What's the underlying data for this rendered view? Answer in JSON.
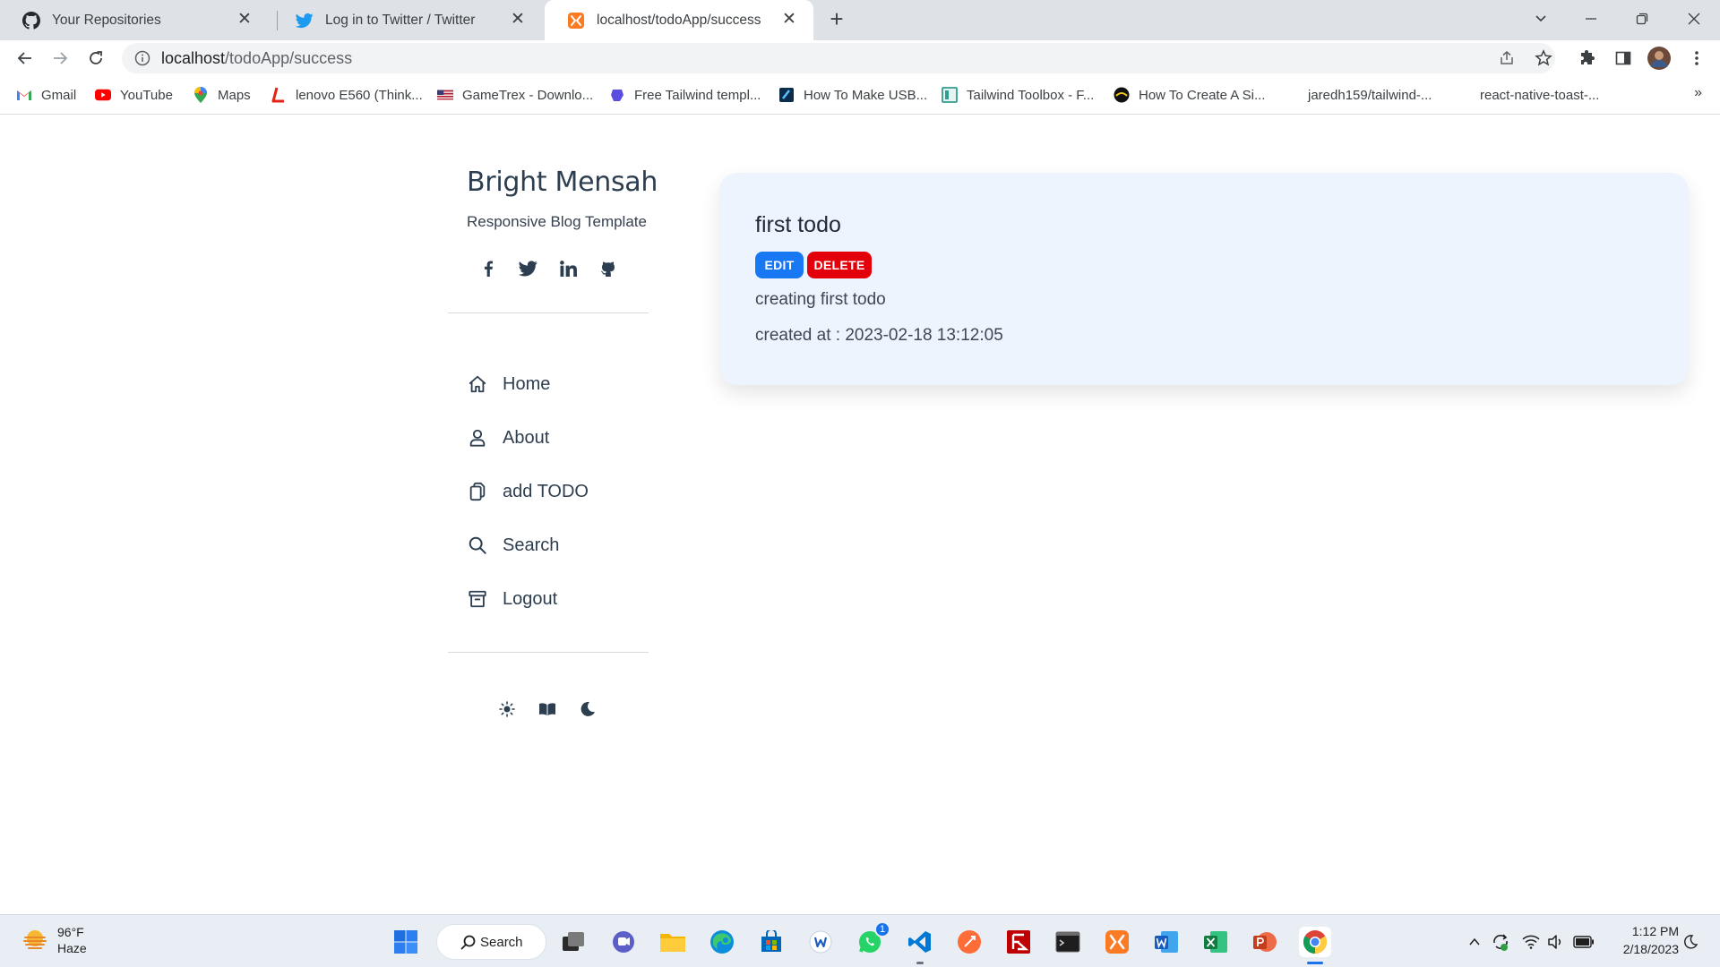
{
  "browser": {
    "tabs": [
      {
        "title": "Your Repositories",
        "icon": "github-icon"
      },
      {
        "title": "Log in to Twitter / Twitter",
        "icon": "twitter-icon"
      },
      {
        "title": "localhost/todoApp/success",
        "icon": "xampp-icon",
        "active": true
      }
    ],
    "address": {
      "host": "localhost",
      "path": "/todoApp/success"
    },
    "bookmarks": [
      {
        "label": "Gmail",
        "icon": "gmail-icon"
      },
      {
        "label": "YouTube",
        "icon": "youtube-icon"
      },
      {
        "label": "Maps",
        "icon": "maps-icon"
      },
      {
        "label": "lenovo E560 (Think...",
        "icon": "lenovo-icon"
      },
      {
        "label": "GameTrex - Downlo...",
        "icon": "gametrex-icon"
      },
      {
        "label": "Free Tailwind templ...",
        "icon": "tailwind-icon"
      },
      {
        "label": "How To Make USB...",
        "icon": "usb-icon"
      },
      {
        "label": "Tailwind Toolbox - F...",
        "icon": "toolbox-icon"
      },
      {
        "label": "How To Create A Si...",
        "icon": "create-icon"
      },
      {
        "label": "jaredh159/tailwind-...",
        "icon": ""
      },
      {
        "label": "react-native-toast-...",
        "icon": ""
      }
    ],
    "bookmarks_more": "»"
  },
  "sidebar": {
    "name": "Bright Mensah",
    "tagline": "Responsive Blog Template",
    "social": [
      "facebook-icon",
      "twitter-icon",
      "linkedin-icon",
      "github-icon"
    ],
    "nav": [
      {
        "label": "Home",
        "icon": "home-icon"
      },
      {
        "label": "About",
        "icon": "user-icon"
      },
      {
        "label": "add TODO",
        "icon": "copy-icon"
      },
      {
        "label": "Search",
        "icon": "search-icon"
      },
      {
        "label": "Logout",
        "icon": "archive-icon"
      }
    ],
    "themes": [
      "sun-icon",
      "book-icon",
      "moon-icon"
    ]
  },
  "todo": {
    "title": "first todo",
    "edit_label": "EDIT",
    "delete_label": "DELETE",
    "description": "creating first todo",
    "created": "created at : 2023-02-18 13:12:05"
  },
  "taskbar": {
    "weather_temp": "96°F",
    "weather_desc": "Haze",
    "search_label": "Search",
    "whatsapp_badge": "1",
    "time": "1:12 PM",
    "date": "2/18/2023"
  },
  "colors": {
    "edit": "#1877f2",
    "delete": "#e3000b",
    "card_bg": "#eef4fd",
    "text_dark": "#2d3e50"
  }
}
